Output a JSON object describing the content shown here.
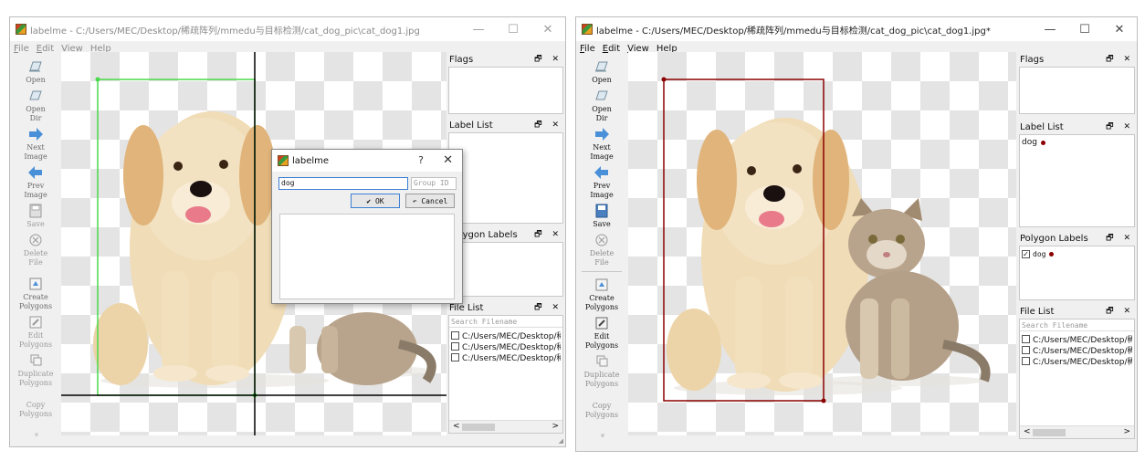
{
  "left_window": {
    "title": "labelme - C:/Users/MEC/Desktop/稀疏阵列/mmedu与目标检测/cat_dog_pic\\cat_dog1.jpg",
    "menu": [
      "File",
      "Edit",
      "View",
      "Help"
    ],
    "window_controls": [
      "—",
      "☐",
      "✕"
    ],
    "toolbar": {
      "open": "Open",
      "open_dir": "Open\nDir",
      "next_image": "Next\nImage",
      "prev_image": "Prev\nImage",
      "save": "Save",
      "delete_file": "Delete\nFile",
      "create_polygons": "Create\nPolygons",
      "edit_polygons": "Edit\nPolygons",
      "duplicate_polygons": "Duplicate\nPolygons",
      "copy_polygons": "Copy\nPolygons",
      "more": "»"
    },
    "docks": {
      "flags": "Flags",
      "label_list": "Label List",
      "polygon_labels": "Polygon Labels",
      "file_list": "File List"
    },
    "dock_controls": "🗗 ✕",
    "file_search_placeholder": "Search Filename",
    "files": [
      "C:/Users/MEC/Desktop/稀",
      "C:/Users/MEC/Desktop/稀",
      "C:/Users/MEC/Desktop/稀"
    ],
    "scroll_left": "<",
    "scroll_right": ">",
    "dialog": {
      "title": "labelme",
      "help": "?",
      "close": "✕",
      "label_value": "dog",
      "group_id_placeholder": "Group ID",
      "ok": "✔ OK",
      "cancel": "↶ Cancel"
    }
  },
  "right_window": {
    "title": "labelme - C:/Users/MEC/Desktop/稀疏阵列/mmedu与目标检测/cat_dog_pic\\cat_dog1.jpg*",
    "menu": [
      "File",
      "Edit",
      "View",
      "Help"
    ],
    "window_controls": [
      "—",
      "☐",
      "✕"
    ],
    "docks": {
      "flags": "Flags",
      "label_list": "Label List",
      "polygon_labels": "Polygon Labels",
      "file_list": "File List"
    },
    "label_list_items": [
      "dog"
    ],
    "polygon_label_items": [
      "dog"
    ],
    "file_search_placeholder": "Search Filename",
    "files": [
      "C:/Users/MEC/Desktop/稀",
      "C:/Users/MEC/Desktop/稀",
      "C:/Users/MEC/Desktop/稀"
    ]
  },
  "colors": {
    "left_box": "#4ad94a",
    "right_box": "#8b0000",
    "icon_blue": "#4a90d9"
  }
}
